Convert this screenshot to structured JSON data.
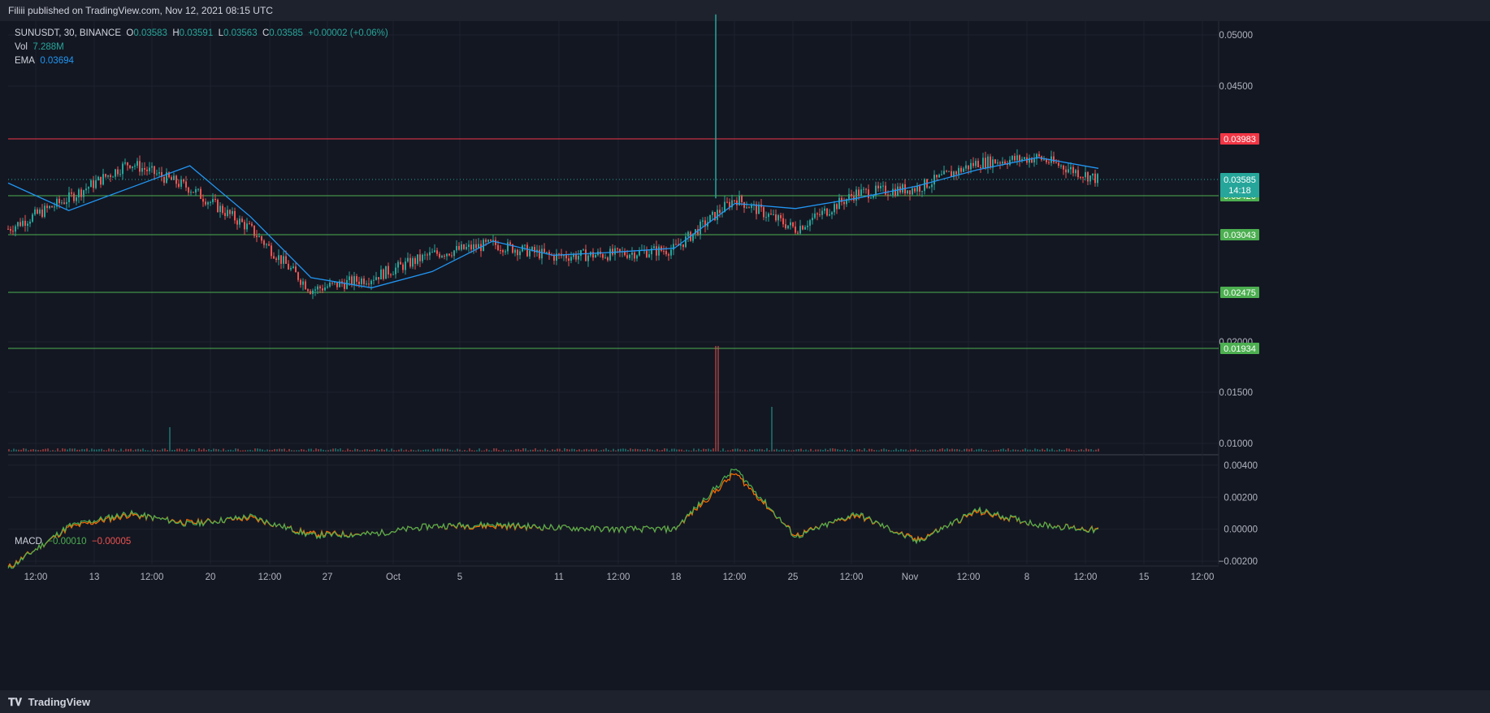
{
  "header": {
    "published": "Filiii published on TradingView.com, Nov 12, 2021 08:15 UTC"
  },
  "legend": {
    "symbol": "SUNUSDT, 30, BINANCE",
    "o_label": "O",
    "o": "0.03583",
    "h_label": "H",
    "h": "0.03591",
    "l_label": "L",
    "l": "0.03563",
    "c_label": "C",
    "c": "0.03585",
    "change": "+0.00002 (+0.06%)",
    "vol_label": "Vol",
    "vol": "7.288M",
    "ema_label": "EMA",
    "ema": "0.03694",
    "macd_label": "MACD",
    "macd_val": "−0.00010",
    "macd_signal": "−0.00005"
  },
  "footer": {
    "brand": "TradingView"
  },
  "colors": {
    "bg": "#131722",
    "up": "#26a69a",
    "down": "#ef5350",
    "ema": "#2962ff",
    "hline_green": "#4caf50",
    "hline_red": "#f23645",
    "macd": "#4caf50",
    "signal": "#ff6d00"
  },
  "chart_data": [
    {
      "type": "line",
      "title": "SUNUSDT, 30, BINANCE",
      "series": [
        {
          "name": "SUNUSDT",
          "style": "candlestick",
          "x": [
            "Sep 11 12:00",
            "Sep 13",
            "Sep 13 12:00",
            "Sep 20",
            "Sep 20 12:00",
            "Sep 27",
            "Oct",
            "Oct 5",
            "Oct 11",
            "Oct 11 12:00",
            "Oct 18",
            "Oct 18 12:00",
            "Oct 25",
            "Oct 25 12:00",
            "Nov",
            "Nov 1 12:00",
            "Nov 8",
            "Nov 8 12:00",
            "Nov 12 07:30"
          ],
          "close": [
            0.031,
            0.034,
            0.0375,
            0.035,
            0.031,
            0.025,
            0.0262,
            0.0285,
            0.0295,
            0.0283,
            0.0285,
            0.029,
            0.034,
            0.031,
            0.0345,
            0.035,
            0.0375,
            0.038,
            0.03585
          ]
        },
        {
          "name": "EMA",
          "x": [
            "Sep 11 12:00",
            "Sep 13",
            "Sep 13 12:00",
            "Sep 20",
            "Sep 20 12:00",
            "Sep 27",
            "Oct",
            "Oct 5",
            "Oct 11",
            "Oct 11 12:00",
            "Oct 18",
            "Oct 18 12:00",
            "Oct 25",
            "Oct 25 12:00",
            "Nov",
            "Nov 1 12:00",
            "Nov 8",
            "Nov 8 12:00",
            "Nov 12 07:30"
          ],
          "values": [
            0.0355,
            0.0328,
            0.035,
            0.0372,
            0.0322,
            0.0262,
            0.0252,
            0.0268,
            0.0298,
            0.0284,
            0.0287,
            0.0291,
            0.0335,
            0.033,
            0.034,
            0.0352,
            0.0368,
            0.038,
            0.03694
          ]
        }
      ],
      "spikes": [
        {
          "x": "Oct 21",
          "high": 0.052,
          "low": 0.034
        }
      ],
      "horizontal_levels": [
        {
          "value": 0.03983,
          "label": "0.03983",
          "color": "red"
        },
        {
          "value": 0.03426,
          "label": "0.03426",
          "color": "green"
        },
        {
          "value": 0.03043,
          "label": "0.03043",
          "color": "green"
        },
        {
          "value": 0.02475,
          "label": "0.02475",
          "color": "green"
        },
        {
          "value": 0.01934,
          "label": "0.01934",
          "color": "green"
        }
      ],
      "last_price": {
        "value": 0.03585,
        "label": "0.03585",
        "countdown": "14:18"
      },
      "y_ticks": [
        "0.05000",
        "0.04500",
        "0.02000",
        "0.01500",
        "0.01000"
      ],
      "ylim": [
        0.0095,
        0.052
      ],
      "x_ticks": [
        "12:00",
        "13",
        "12:00",
        "20",
        "12:00",
        "27",
        "Oct",
        "5",
        "11",
        "12:00",
        "18",
        "12:00",
        "25",
        "12:00",
        "Nov",
        "12:00",
        "8",
        "12:00",
        "15",
        "12:00"
      ],
      "grid": true
    },
    {
      "type": "bar",
      "title": "Vol",
      "values_note": "volume histogram at bottom of price pane",
      "spike_x": "Oct 21"
    },
    {
      "type": "line",
      "title": "MACD",
      "series": [
        {
          "name": "MACD",
          "values": [
            -0.0025,
            0.0002,
            0.001,
            0.0003,
            0.0008,
            -0.0004,
            -0.0003,
            0.0002,
            0.0003,
            0.0001,
            0.0,
            0.0,
            0.0038,
            -0.0005,
            0.001,
            -0.0008,
            0.0012,
            0.0003,
            -0.0001
          ]
        },
        {
          "name": "Signal",
          "values": [
            -0.0024,
            0.0001,
            0.0009,
            0.0004,
            0.0007,
            -0.0003,
            -0.0003,
            0.0002,
            0.0002,
            0.0001,
            0.0,
            0.0,
            0.0035,
            -0.0004,
            0.0009,
            -0.0007,
            0.0011,
            0.0003,
            -5e-05
          ]
        }
      ],
      "y_ticks": [
        "0.00400",
        "0.00200",
        "0.00000",
        "−0.00200"
      ],
      "ylim": [
        -0.0022,
        0.0045
      ],
      "grid": true
    }
  ]
}
